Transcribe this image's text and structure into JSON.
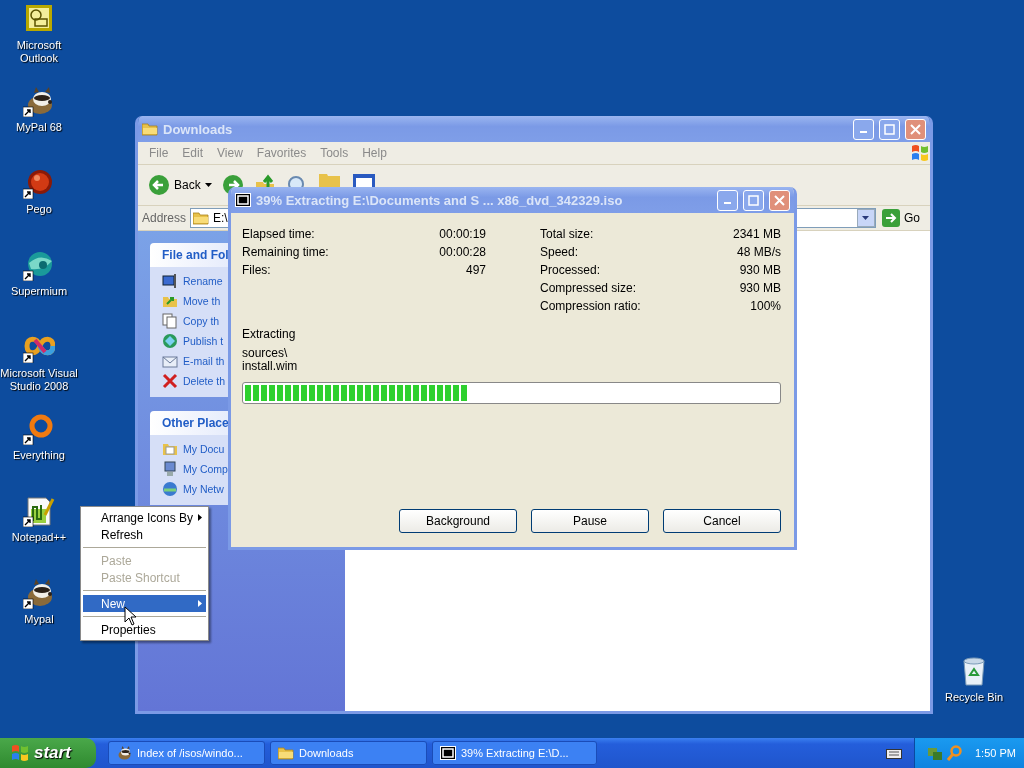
{
  "desktop_icons": [
    {
      "label": "Microsoft Outlook"
    },
    {
      "label": "MyPal 68"
    },
    {
      "label": "Pego"
    },
    {
      "label": "Supermium"
    },
    {
      "label": "Microsoft Visual Studio 2008"
    },
    {
      "label": "Everything"
    },
    {
      "label": "Notepad++"
    },
    {
      "label": "Mypal"
    }
  ],
  "recycle_bin": {
    "label": "Recycle Bin"
  },
  "explorer": {
    "title": "Downloads",
    "menu": [
      "File",
      "Edit",
      "View",
      "Favorites",
      "Tools",
      "Help"
    ],
    "back": "Back",
    "address_label": "Address",
    "address": "E:\\",
    "go": "Go",
    "panels": [
      {
        "title": "File and Fol",
        "items": [
          "Rename",
          "Move th",
          "Copy th",
          "Publish t",
          "E-mail th",
          "Delete th"
        ]
      },
      {
        "title": "Other Place",
        "items": [
          "My Docu",
          "My Comp",
          "My Netw"
        ]
      }
    ]
  },
  "dialog": {
    "title": "39% Extracting E:\\Documents and S ... x86_dvd_342329.iso",
    "left_stats": [
      {
        "label": "Elapsed time:",
        "value": "00:00:19"
      },
      {
        "label": "Remaining time:",
        "value": "00:00:28"
      },
      {
        "label": "Files:",
        "value": "497"
      }
    ],
    "right_stats": [
      {
        "label": "Total size:",
        "value": "2341 MB"
      },
      {
        "label": "Speed:",
        "value": "48 MB/s"
      },
      {
        "label": "Processed:",
        "value": "930 MB"
      },
      {
        "label": "Compressed size:",
        "value": "930 MB"
      },
      {
        "label": "Compression ratio:",
        "value": "100%"
      }
    ],
    "status": "Extracting",
    "path": [
      "sources\\",
      "install.wim"
    ],
    "level": 0.42,
    "buttons": [
      "Background",
      "Pause",
      "Cancel"
    ]
  },
  "context_menu": [
    {
      "kind": "item",
      "label": "Arrange Icons By",
      "submenu": true,
      "disabled": false,
      "selected": false
    },
    {
      "kind": "item",
      "label": "Refresh",
      "submenu": false,
      "disabled": false,
      "selected": false
    },
    {
      "kind": "separator"
    },
    {
      "kind": "item",
      "label": "Paste",
      "submenu": false,
      "disabled": true,
      "selected": false
    },
    {
      "kind": "item",
      "label": "Paste Shortcut",
      "submenu": false,
      "disabled": true,
      "selected": false
    },
    {
      "kind": "separator"
    },
    {
      "kind": "item",
      "label": "New",
      "submenu": true,
      "disabled": false,
      "selected": true
    },
    {
      "kind": "separator"
    },
    {
      "kind": "item",
      "label": "Properties",
      "submenu": false,
      "disabled": false,
      "selected": false
    }
  ],
  "taskbar": {
    "start": "start",
    "tasks": [
      {
        "label": "Index of /isos/windo..."
      },
      {
        "label": "Downloads"
      },
      {
        "label": "39% Extracting E:\\D..."
      }
    ],
    "clock": "1:50 PM"
  }
}
